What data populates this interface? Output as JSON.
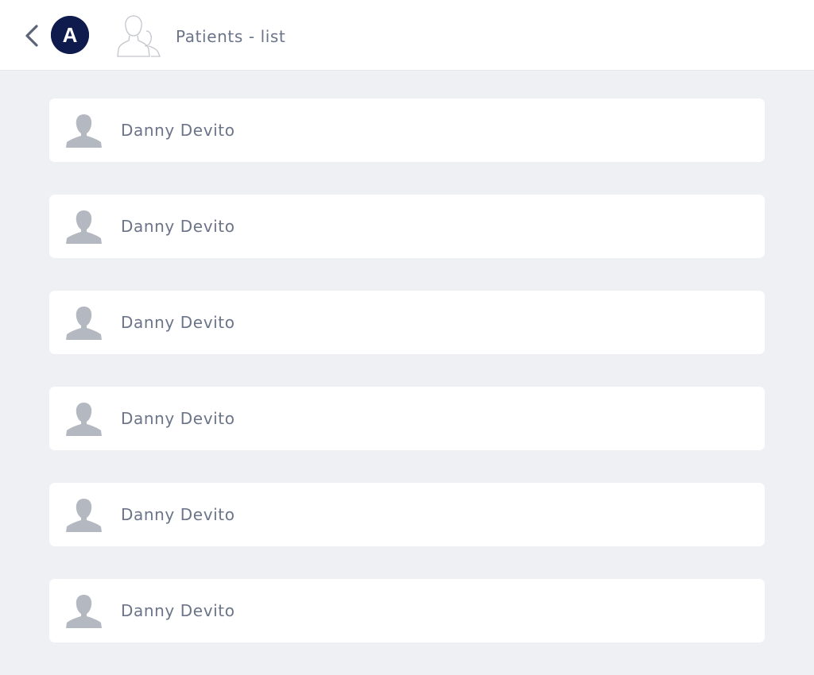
{
  "header": {
    "back_icon": "chevron-left-icon",
    "logo_letter": "A",
    "title_icon": "patients-icon",
    "title": "Patients - list"
  },
  "patients": [
    {
      "name": "Danny Devito",
      "icon": "user-avatar-icon"
    },
    {
      "name": "Danny Devito",
      "icon": "user-avatar-icon"
    },
    {
      "name": "Danny Devito",
      "icon": "user-avatar-icon"
    },
    {
      "name": "Danny Devito",
      "icon": "user-avatar-icon"
    },
    {
      "name": "Danny Devito",
      "icon": "user-avatar-icon"
    },
    {
      "name": "Danny Devito",
      "icon": "user-avatar-icon"
    }
  ],
  "colors": {
    "background": "#eef0f4",
    "header": "#ffffff",
    "card": "#ffffff",
    "text": "#6b7488",
    "logo": "#0f1a4d",
    "avatar": "#b4b8c0"
  }
}
